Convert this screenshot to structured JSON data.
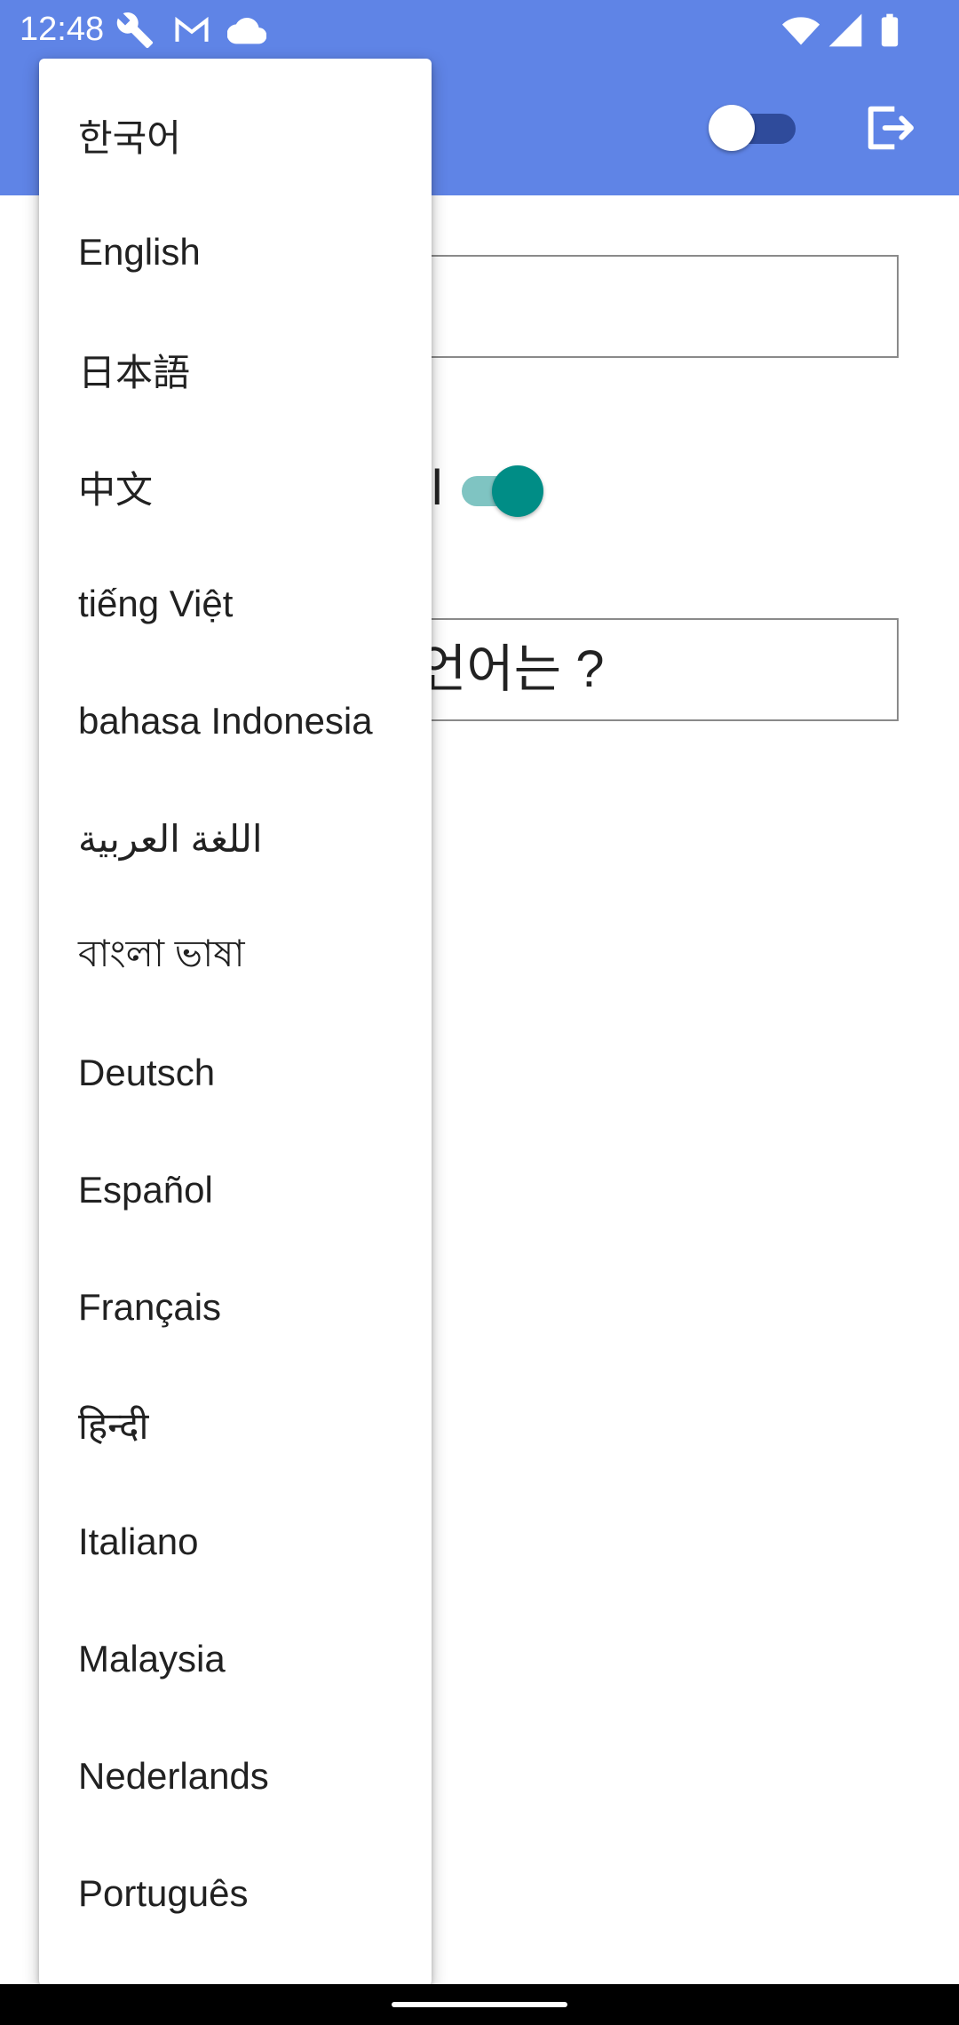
{
  "status_bar": {
    "time": "12:48",
    "icons": [
      "wrench-icon",
      "gmail-icon",
      "cloud-icon",
      "wifi-icon",
      "signal-icon",
      "battery-icon"
    ]
  },
  "app_bar": {
    "color": "#5f84e6",
    "toggle_state": "off",
    "logout_icon": "logout-icon"
  },
  "background_content": {
    "label_visible_fragment": "l",
    "switch_state": "on",
    "language_field_text": "언어는 ?"
  },
  "language_menu": {
    "items": [
      "한국어",
      "English",
      "日本語",
      "中文",
      "tiếng Việt",
      "bahasa Indonesia",
      "اللغة العربية",
      "বাংলা ভাষা",
      "Deutsch",
      "Español",
      "Français",
      "हिन्दी",
      "Italiano",
      "Malaysia",
      "Nederlands",
      "Português"
    ]
  },
  "colors": {
    "accent_teal": "#008d86",
    "appbar_blue": "#5f84e6"
  }
}
